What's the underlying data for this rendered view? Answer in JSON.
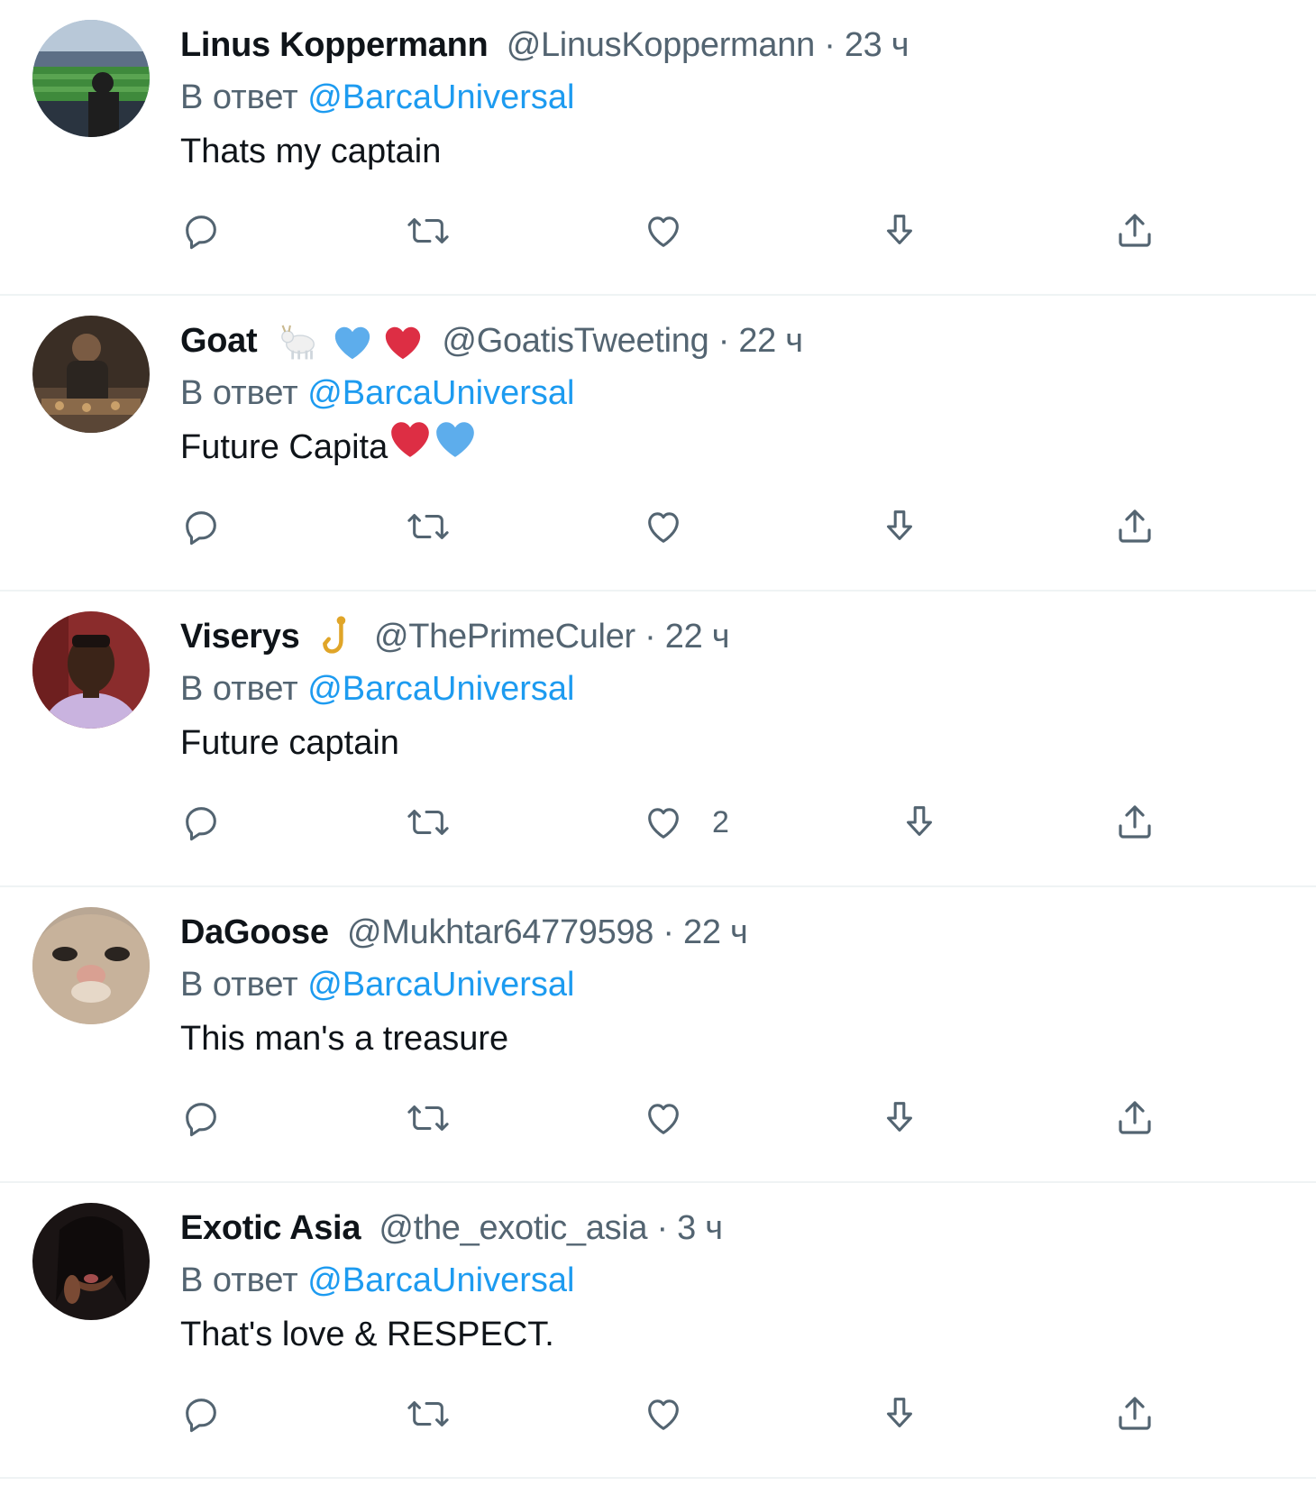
{
  "tweets": [
    {
      "name": "Linus Koppermann",
      "handle": "@LinusKoppermann",
      "dot": "·",
      "time": "23 ч",
      "reply_prefix": "В ответ",
      "reply_to": "@BarcaUniversal",
      "text": "Thats my captain",
      "like_count": "",
      "name_emojis": [],
      "text_emojis": [],
      "avatar_icon": "stadium-photo"
    },
    {
      "name": "Goat",
      "handle": "@GoatisTweeting",
      "dot": "·",
      "time": "22 ч",
      "reply_prefix": "В ответ",
      "reply_to": "@BarcaUniversal",
      "text": "Future Capita",
      "like_count": "",
      "name_emojis": [
        "goat-emoji",
        "blue-heart-emoji",
        "red-heart-emoji"
      ],
      "text_emojis": [
        "red-heart-emoji",
        "blue-heart-emoji"
      ],
      "avatar_icon": "dark-portrait"
    },
    {
      "name": "Viserys",
      "handle": "@ThePrimeCuler",
      "dot": "·",
      "time": "22 ч",
      "reply_prefix": "В ответ",
      "reply_to": "@BarcaUniversal",
      "text": "Future captain",
      "like_count": "2",
      "name_emojis": [
        "hook-emoji"
      ],
      "text_emojis": [],
      "avatar_icon": "man-lilac-hoodie"
    },
    {
      "name": "DaGoose",
      "handle": "@Mukhtar64779598",
      "dot": "·",
      "time": "22 ч",
      "reply_prefix": "В ответ",
      "reply_to": "@BarcaUniversal",
      "text": "This man's a treasure",
      "like_count": "",
      "name_emojis": [],
      "text_emojis": [],
      "avatar_icon": "cat-closeup"
    },
    {
      "name": "Exotic Asia",
      "handle": "@the_exotic_asia",
      "dot": "·",
      "time": "3 ч",
      "reply_prefix": "В ответ",
      "reply_to": "@BarcaUniversal",
      "text": "That's love & RESPECT.",
      "like_count": "",
      "name_emojis": [],
      "text_emojis": [],
      "avatar_icon": "woman-portrait"
    }
  ],
  "action_icons": [
    "reply-icon",
    "retweet-icon",
    "like-icon",
    "bookmark-icon",
    "share-icon"
  ],
  "colors": {
    "text": "#0f1419",
    "secondary": "#536471",
    "link": "#1d9bf0",
    "divider": "#eff3f4",
    "heart_red": "#dd2e44",
    "heart_blue": "#5dadec"
  }
}
